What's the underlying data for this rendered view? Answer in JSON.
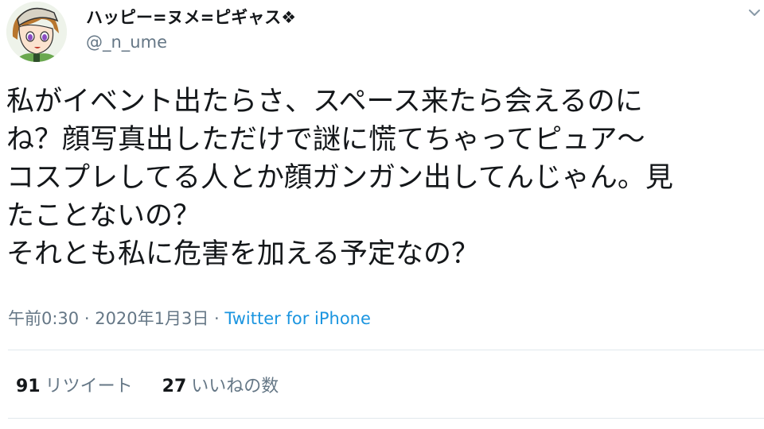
{
  "author": {
    "display_name": "ハッピー=ヌメ=ピギャス❖",
    "handle": "@_n_ume"
  },
  "tweet": {
    "lines": [
      "私がイベント出たらさ、スペース来たら会えるのに",
      "ね？顔写真出しただけで謎に慌てちゃってピュア～",
      "コスプレしてる人とか顔ガンガン出してんじゃん。見",
      "たことないの？",
      "それとも私に危害を加える予定なの？"
    ]
  },
  "meta": {
    "time": "午前0:30",
    "separator1": " · ",
    "date": "2020年1月3日",
    "separator2": " · ",
    "source": "Twitter for iPhone"
  },
  "stats": {
    "retweets_count": "91",
    "retweets_label": "リツイート",
    "likes_count": "27",
    "likes_label": "いいねの数"
  },
  "icons": {
    "avatar": "avatar-illustration",
    "caret": "chevron-down-icon"
  },
  "colors": {
    "text": "#14171a",
    "secondary": "#657786",
    "link": "#1b95e0",
    "divider": "#e1e8ed"
  }
}
